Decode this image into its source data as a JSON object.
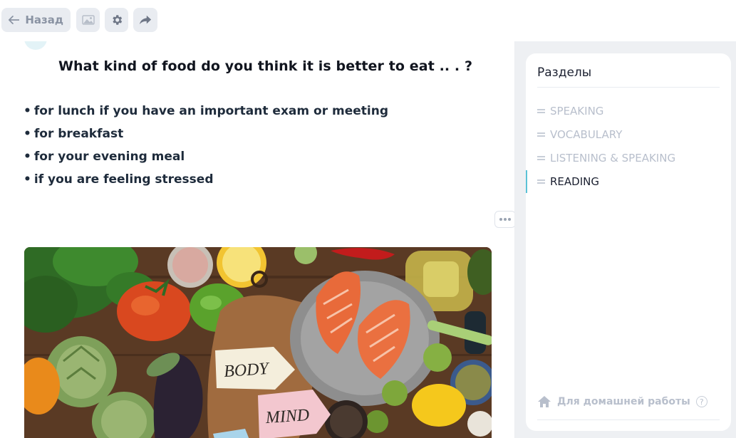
{
  "toolbar": {
    "back_label": "Назад",
    "icons": [
      "arrow-left-icon",
      "image-icon",
      "gear-icon",
      "share-icon"
    ]
  },
  "lesson": {
    "question": "What kind of food do you think it is better to eat .. . ?",
    "bullets": [
      "for lunch if you have an important exam or meeting",
      "for breakfast",
      "for your evening meal",
      "if you are feeling stressed"
    ],
    "image_signs": [
      "BODY",
      "MIND"
    ]
  },
  "sidebar": {
    "title": "Разделы",
    "items": [
      {
        "label": "SPEAKING",
        "active": false
      },
      {
        "label": "VOCABULARY",
        "active": false
      },
      {
        "label": "LISTENING & SPEAKING",
        "active": false
      },
      {
        "label": "READING",
        "active": true
      }
    ],
    "homework_label": "Для домашней работы",
    "help_glyph": "?"
  },
  "colors": {
    "accent": "#5bc2d6",
    "muted_text": "#b8bfcc",
    "button_bg": "#e9ecf1"
  }
}
